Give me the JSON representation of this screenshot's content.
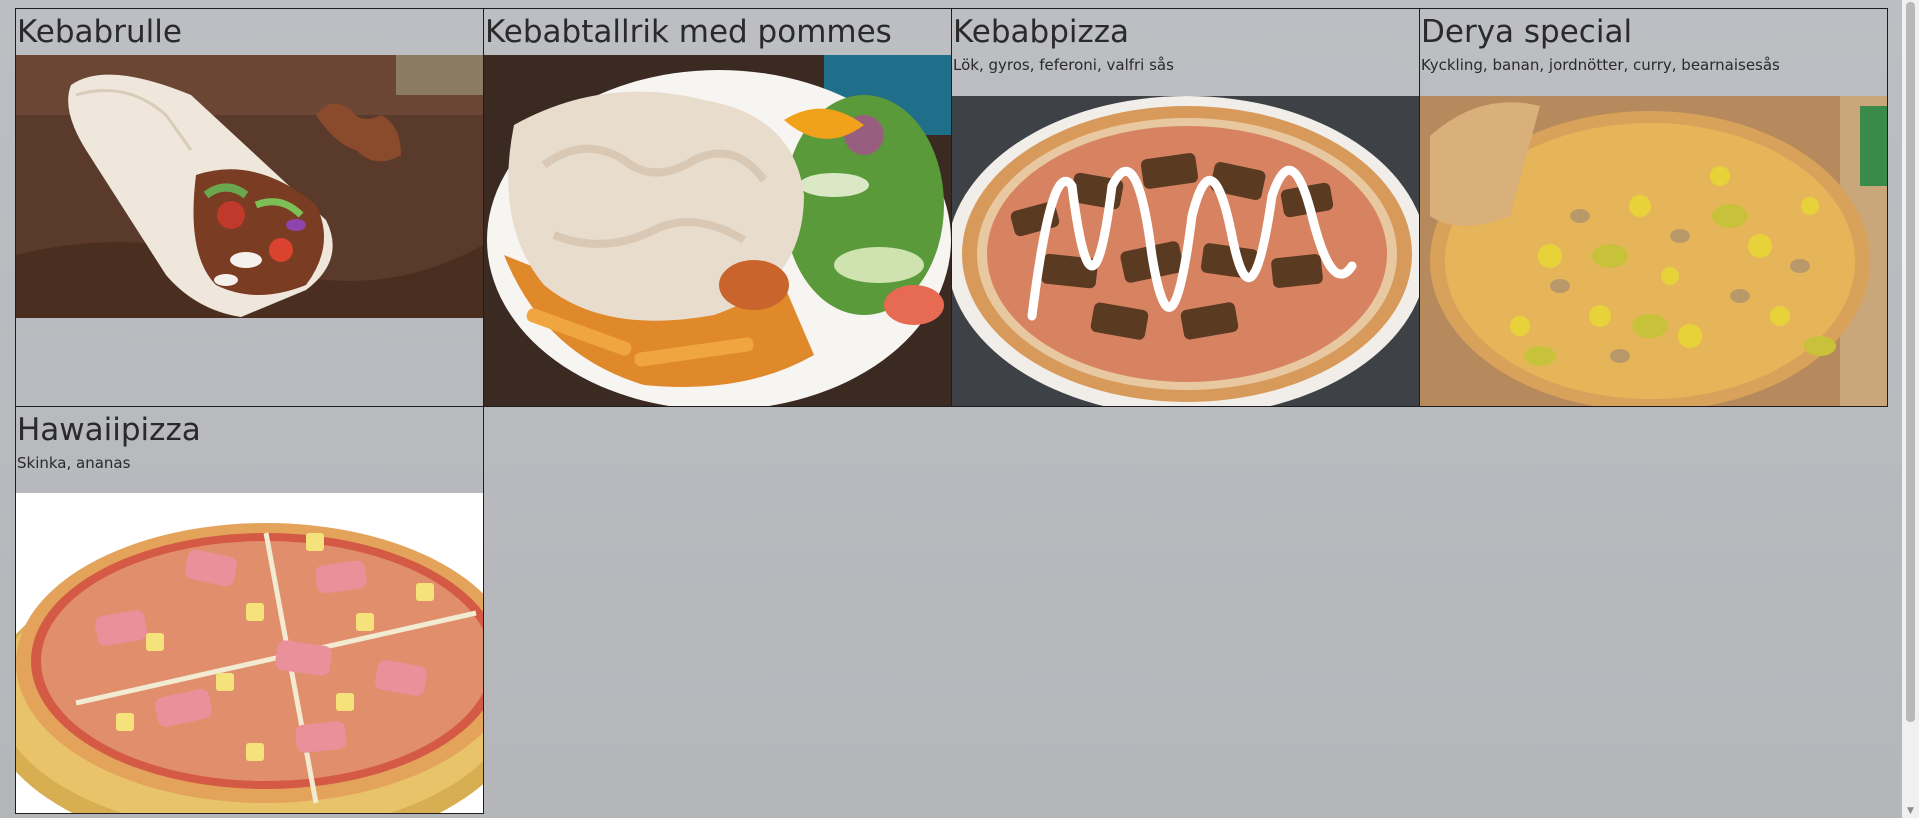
{
  "menu": {
    "items": [
      {
        "title": "Kebabrulle",
        "description": "",
        "image_icon": "kebab-wrap-photo"
      },
      {
        "title": "Kebabtallrik med pommes",
        "description": "",
        "image_icon": "kebab-plate-photo"
      },
      {
        "title": "Kebabpizza",
        "description": "Lök, gyros, feferoni, valfri sås",
        "image_icon": "kebab-pizza-photo"
      },
      {
        "title": "Derya special",
        "description": "Kyckling, banan, jordnötter, curry, bearnaisesås",
        "image_icon": "derya-pizza-photo"
      },
      {
        "title": "Hawaiipizza",
        "description": "Skinka, ananas",
        "image_icon": "hawaii-pizza-photo"
      }
    ]
  },
  "colors": {
    "page_background": "#bcbec3",
    "card_border": "#1e1e1e",
    "text": "#2a2a2a"
  }
}
